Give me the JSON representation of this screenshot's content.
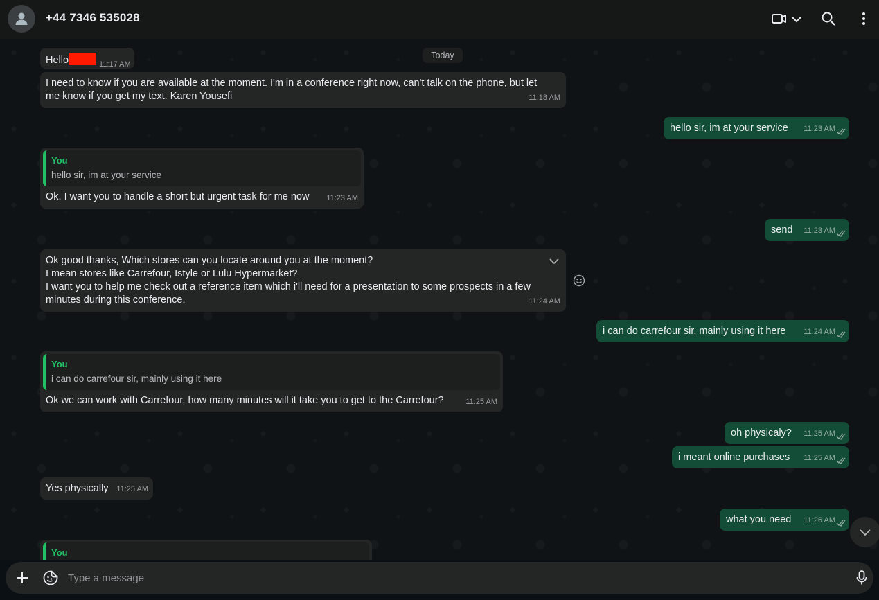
{
  "header": {
    "contact_name": "+44 7346 535028",
    "icons": [
      "person-icon",
      "video-call-icon",
      "chevron-down-icon",
      "search-icon",
      "menu-dots-icon"
    ]
  },
  "chat": {
    "date_divider": "Today",
    "messages": [
      {
        "direction": "in",
        "text": "Hello",
        "time": "11:17 AM"
      },
      {
        "direction": "in",
        "text": "I need to know if you are available at the moment.  I'm in a conference right now, can't talk on the phone, but let me know if you get my text. Karen Yousefi",
        "time": "11:18 AM"
      },
      {
        "direction": "out",
        "text": "hello sir, im at your service",
        "time": "11:23 AM"
      },
      {
        "direction": "in",
        "quote_author": "You",
        "quote_text": "hello sir, im at your service",
        "text": "Ok, I want you to handle a short but urgent task for me now",
        "time": "11:23 AM"
      },
      {
        "direction": "out",
        "text": "send",
        "time": "11:23 AM"
      },
      {
        "direction": "in",
        "line1": "Ok good thanks, Which stores can you locate around you at the moment?",
        "line2": "I mean stores like Carrefour, Istyle or Lulu Hypermarket?",
        "line3": "I want you to help me check out a reference item which i'll need for a presentation to some prospects in a few minutes during this conference.",
        "time": "11:24 AM"
      },
      {
        "direction": "out",
        "text": "i can do carrefour sir, mainly using it here",
        "time": "11:24 AM"
      },
      {
        "direction": "in",
        "quote_author": "You",
        "quote_text": "i can do carrefour sir, mainly using it here",
        "text": "Ok we can work with Carrefour, how many minutes will it take you to get to the Carrefour?",
        "time": "11:25 AM"
      },
      {
        "direction": "out",
        "text": "oh physicaly?",
        "time": "11:25 AM"
      },
      {
        "direction": "out",
        "text": "i meant online purchases",
        "time": "11:25 AM"
      },
      {
        "direction": "in",
        "text": "Yes physically",
        "time": "11:25 AM"
      },
      {
        "direction": "out",
        "text": "what you need",
        "time": "11:26 AM"
      },
      {
        "direction": "in",
        "quote_author": "You"
      }
    ]
  },
  "composer": {
    "placeholder": "Type a message",
    "icons": [
      "plus-icon",
      "sticker-icon",
      "microphone-icon"
    ]
  },
  "colors": {
    "incoming_bubble": "#242626",
    "outgoing_bubble": "#144d37",
    "accent": "#21c063",
    "redaction": "#ff1a00"
  }
}
